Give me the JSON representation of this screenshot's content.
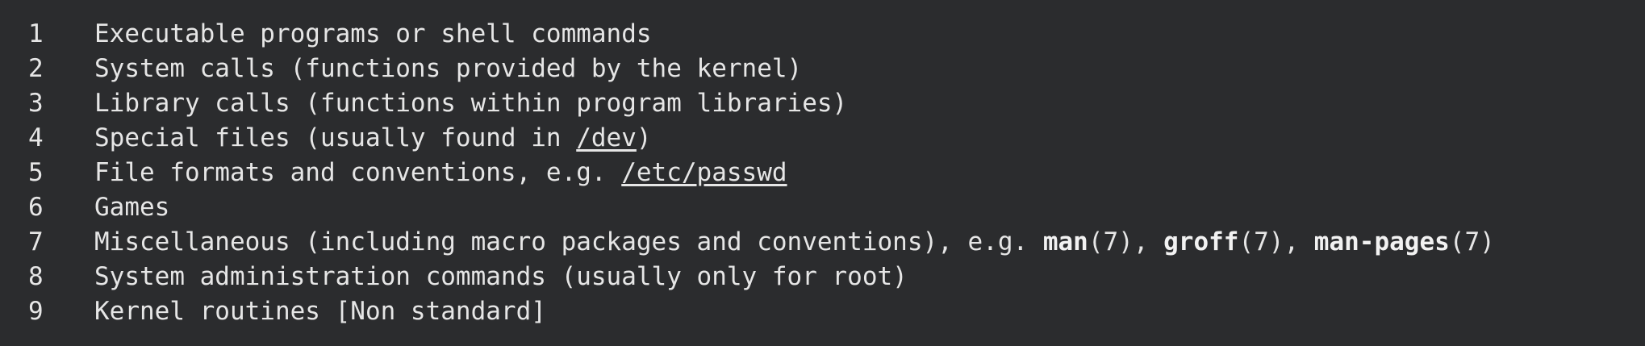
{
  "sections": [
    {
      "number": "1",
      "text": "Executable programs or shell commands"
    },
    {
      "number": "2",
      "text": "System calls (functions provided by the kernel)"
    },
    {
      "number": "3",
      "text": "Library calls (functions within program libraries)"
    },
    {
      "number": "4",
      "text_before": "Special files (usually found in ",
      "link": "/dev",
      "text_after": ")"
    },
    {
      "number": "5",
      "text_before": "File formats and conventions, e.g. ",
      "link": "/etc/passwd"
    },
    {
      "number": "6",
      "text": "Games"
    },
    {
      "number": "7",
      "text_before": "Miscellaneous (including macro packages and conventions), e.g. ",
      "ref1_name": "man",
      "ref1_section": "(7)",
      "sep1": ", ",
      "ref2_name": "groff",
      "ref2_section": "(7)",
      "sep2": ", ",
      "ref3_name": "man-pages",
      "ref3_section": "(7)"
    },
    {
      "number": "8",
      "text": "System administration commands (usually only for root)"
    },
    {
      "number": "9",
      "text": "Kernel routines [Non standard]"
    }
  ],
  "colors": {
    "background": "#2b2c2e",
    "foreground": "#e6e6e6"
  }
}
